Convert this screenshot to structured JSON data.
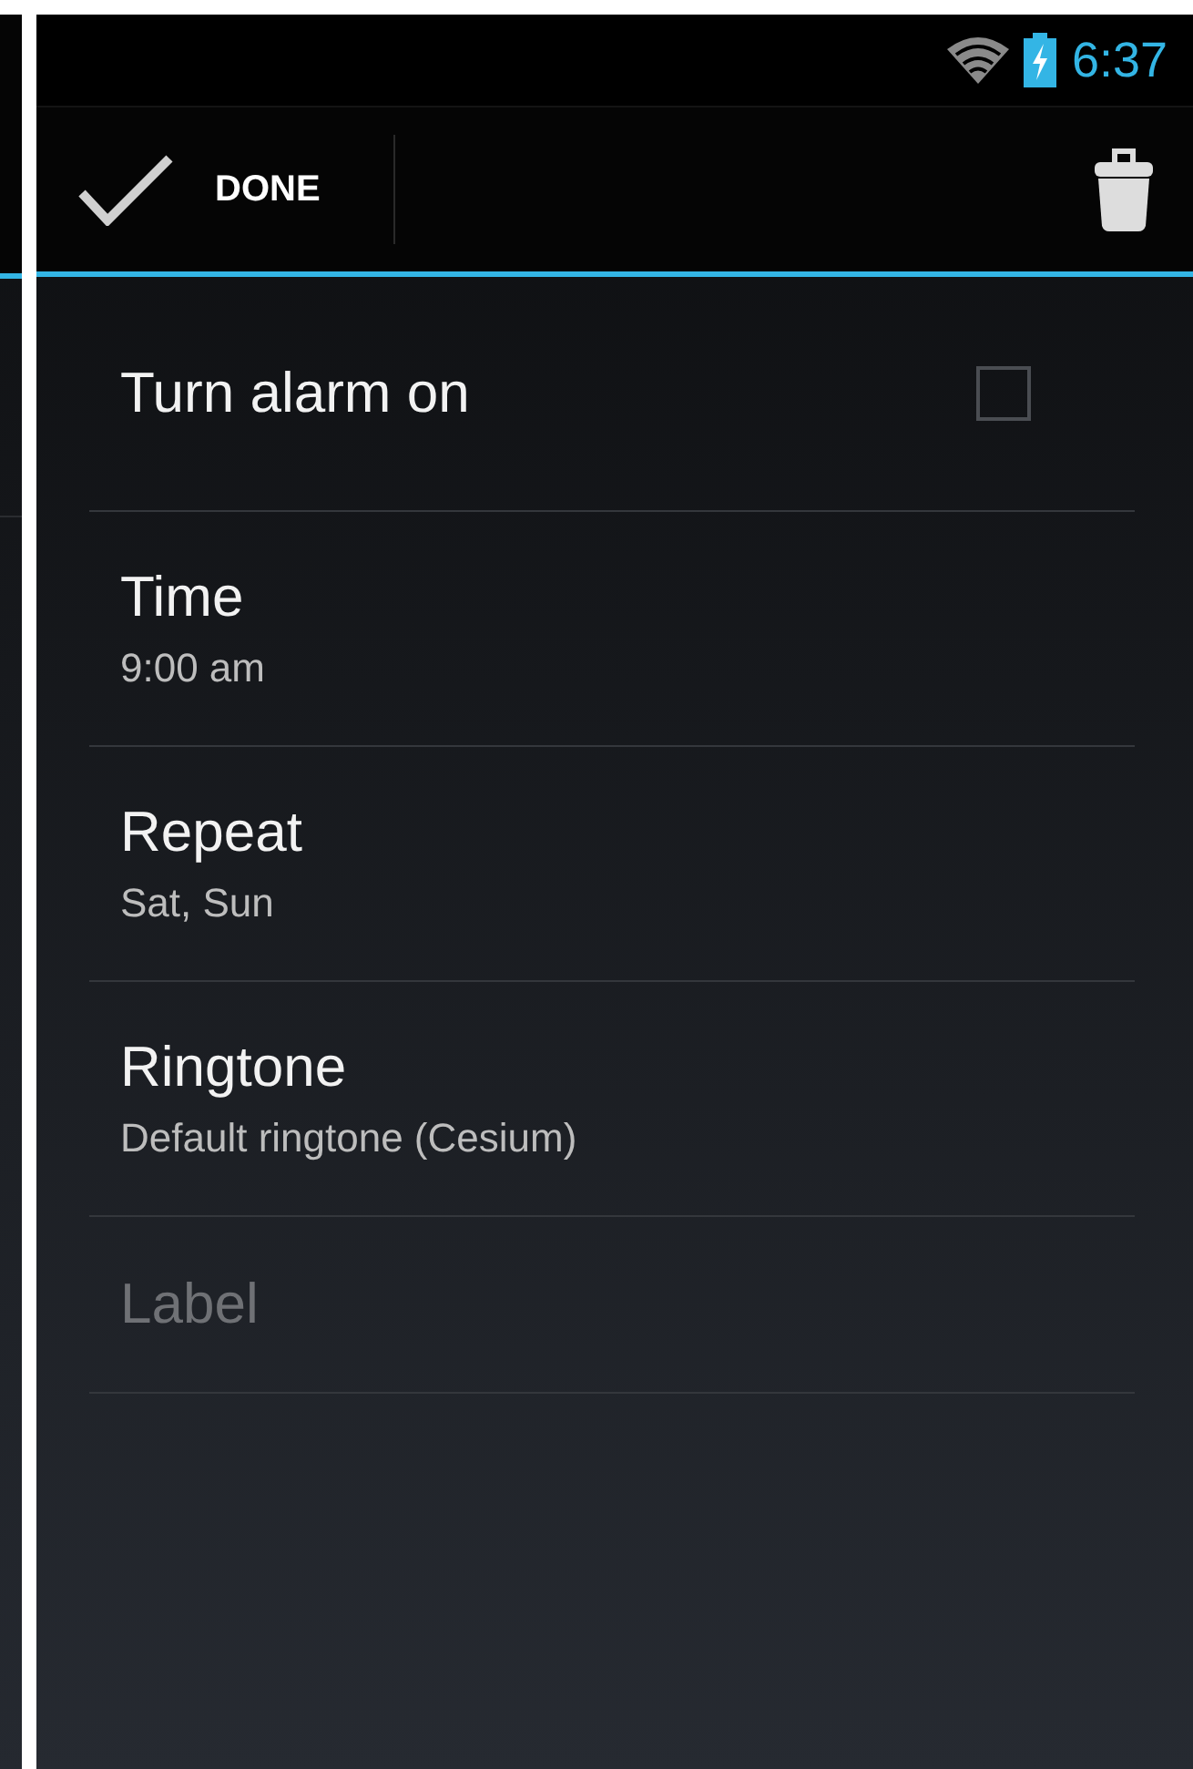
{
  "status_bar": {
    "time": "6:37"
  },
  "action_bar": {
    "done_label": "DONE"
  },
  "settings": [
    {
      "kind": "checkbox",
      "title": "Turn alarm on",
      "checked": false
    },
    {
      "kind": "detail",
      "title": "Time",
      "summary": "9:00 am"
    },
    {
      "kind": "detail",
      "title": "Repeat",
      "summary": "Sat, Sun"
    },
    {
      "kind": "detail",
      "title": "Ringtone",
      "summary": "Default ringtone (Cesium)"
    },
    {
      "kind": "field",
      "placeholder": "Label"
    }
  ]
}
